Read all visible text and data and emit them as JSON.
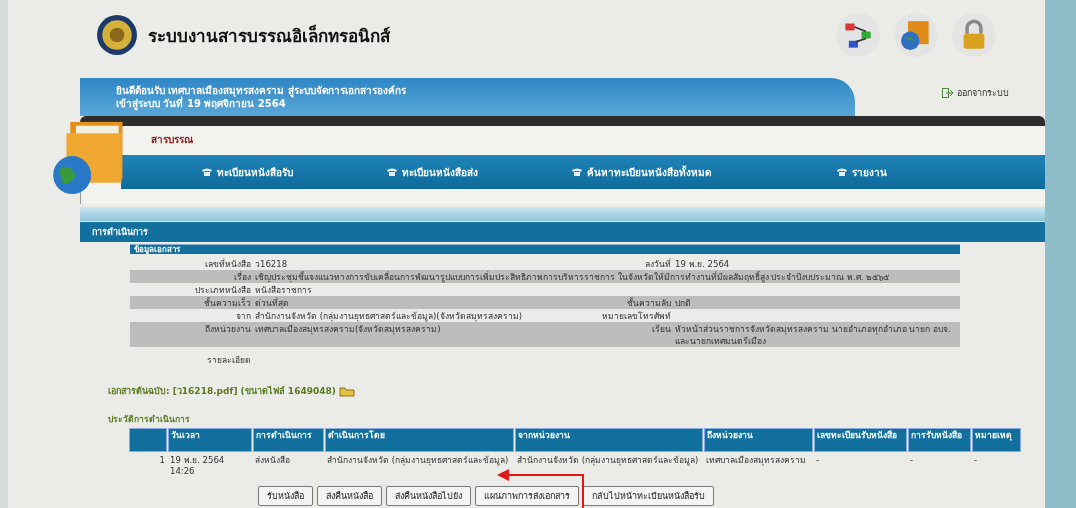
{
  "header": {
    "title": "ระบบงานสารบรรณอิเล็กทรอนิกส์",
    "welcome": [
      "ยินดีต้อนรับ เทศบาลเมืองสมุทรสงคราม สู่ระบบจัดการเอกสารองค์กร",
      "เข้าสู่ระบบ วันที่ 19 พฤศจิกายน 2564"
    ],
    "logout": "ออกจากระบบ"
  },
  "section": {
    "title": "สารบรรณ",
    "menu": [
      "ทะเบียนหนังสือรับ",
      "ทะเบียนหนังสือส่ง",
      "ค้นหาทะเบียนหนังสือทั้งหมด",
      "รายงาน"
    ]
  },
  "panel": {
    "title": "การดำเนินการ",
    "subtitle": "ข้อมูลเอกสาร",
    "rows": [
      {
        "fields": [
          {
            "label": "เลขที่หนังสือ",
            "value": "ว16218"
          },
          {
            "label": "ลงวันที่",
            "value": "19 พ.ย. 2564"
          }
        ]
      },
      {
        "fields": [
          {
            "label": "เรื่อง",
            "value": "เชิญประชุมชี้แจงแนวทางการขับเคลื่อนการพัฒนารูปแบบการเพิ่มประสิทธิภาพการบริหารราชการ ในจังหวัดให้มีการทำงานที่มีผลสัมฤทธิ์สูง ประจำปีงบประมาณ พ.ศ. ๒๕๖๕"
          }
        ]
      },
      {
        "fields": [
          {
            "label": "ประเภทหนังสือ",
            "value": "หนังสือราชการ"
          }
        ]
      },
      {
        "fields": [
          {
            "label": "ชั้นความเร็ว",
            "value": "ด่วนที่สุด"
          },
          {
            "label": "ชั้นความลับ",
            "value": "ปกติ"
          }
        ]
      },
      {
        "fields": [
          {
            "label": "จาก",
            "value": "สำนักงานจังหวัด (กลุ่มงานยุทธศาสตร์และข้อมูล)(จังหวัดสมุทรสงคราม)"
          },
          {
            "label": "หมายเลขโทรศัพท์"
          }
        ]
      },
      {
        "fields": [
          {
            "label": "ถึงหน่วยงาน",
            "value": "เทศบาลเมืองสมุทรสงคราม(จังหวัดสมุทรสงคราม)"
          },
          {
            "label": "เรียน",
            "value": "หัวหน้าส่วนราชการจังหวัดสมุทรสงคราม นายอำเภอทุกอำเภอ นายก อบจ. และนายกเทศมนตรีเมือง"
          }
        ]
      },
      {
        "fields": [
          {
            "label": "รายละเอียด"
          }
        ]
      }
    ],
    "attachment": "เอกสารต้นฉบับ: [ว16218.pdf] (ขนาดไฟล์ 1649048)",
    "history": {
      "title": "ประวัติการดำเนินการ",
      "columns": [
        "",
        "วันเวลา",
        "การดำเนินการ",
        "ดำเนินการโดย",
        "จากหน่วยงาน",
        "ถึงหน่วยงาน",
        "เลขทะเบียนรับหนังสือ",
        "การรับหนังสือ",
        "หมายเหตุ"
      ],
      "rows": [
        [
          "1",
          "19 พ.ย. 2564 14:26",
          "ส่งหนังสือ",
          "สำนักงานจังหวัด (กลุ่มงานยุทธศาสตร์และข้อมูล)",
          "สำนักงานจังหวัด (กลุ่มงานยุทธศาสตร์และข้อมูล)",
          "เทศบาลเมืองสมุทรสงคราม",
          "-",
          "-",
          "-"
        ]
      ]
    },
    "buttons": [
      "รับหนังสือ",
      "ส่งคืนหนังสือ",
      "ส่งคืนหนังสือไปยัง",
      "แผนภาพการส่งเอกสาร",
      "กลับไปหน้าทะเบียนหนังสือรับ"
    ]
  }
}
